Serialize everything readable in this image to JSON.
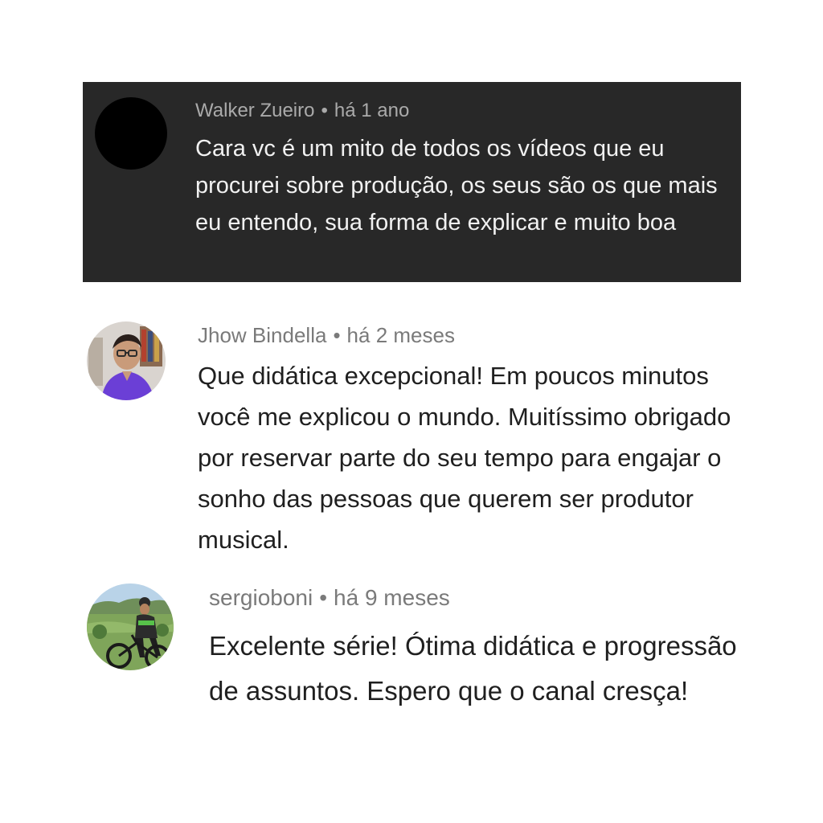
{
  "comments": [
    {
      "author": "Walker Zueiro",
      "separator": "•",
      "time": "há 1 ano",
      "text": "Cara vc é um mito de todos os vídeos que eu procurei sobre produção, os seus são os que mais eu entendo, sua forma de explicar e muito boa",
      "avatar_icon": "black-circle-avatar",
      "background": "#282828"
    },
    {
      "author": "Jhow Bindella",
      "separator": "•",
      "time": "há 2 meses",
      "text": "Que didática excepcional! Em poucos minutos você me explicou o mundo. Muitíssimo obrigado por reservar parte do seu tempo para engajar o sonho das pessoas que querem ser produtor musical.",
      "avatar_icon": "person-photo-avatar"
    },
    {
      "author": "sergioboni",
      "separator": "•",
      "time": "há 9 meses",
      "text": "Excelente série! Ótima didática e progressão de assuntos. Espero que o canal cresça!",
      "avatar_icon": "cyclist-photo-avatar"
    }
  ]
}
